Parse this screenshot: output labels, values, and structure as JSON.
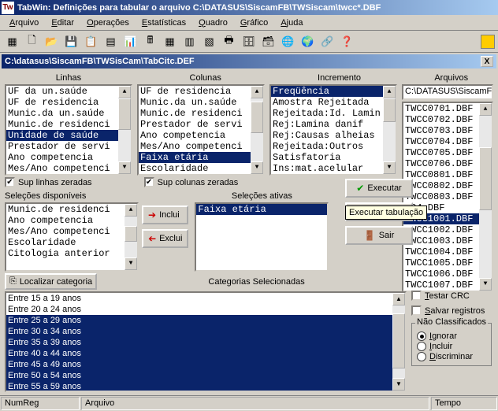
{
  "window": {
    "app_icon": "Tw",
    "title": "TabWin: Definições para tabular o arquivo C:\\DATASUS\\SiscamFB\\TWSiscam\\twcc*.DBF"
  },
  "menu": {
    "arquivo": "Arquivo",
    "editar": "Editar",
    "operacoes": "Operações",
    "estatisticas": "Estatísticas",
    "quadro": "Quadro",
    "grafico": "Gráfico",
    "ajuda": "Ajuda"
  },
  "inner_window": {
    "title": "C:\\datasus\\SiscamFB\\TWSisCam\\TabCitc.DEF",
    "close": "X"
  },
  "headers": {
    "linhas": "Linhas",
    "colunas": "Colunas",
    "incremento": "Incremento",
    "arquivos": "Arquivos"
  },
  "linhas_items": [
    {
      "t": "UF da un.saúde",
      "sel": 0
    },
    {
      "t": "UF de residencia",
      "sel": 0
    },
    {
      "t": "Munic.da un.saúde",
      "sel": 0
    },
    {
      "t": "Munic.de residenci",
      "sel": 0
    },
    {
      "t": "Unidade de saúde",
      "sel": 1
    },
    {
      "t": "Prestador de servi",
      "sel": 0
    },
    {
      "t": "Ano competencia",
      "sel": 0
    },
    {
      "t": "Mes/Ano competenci",
      "sel": 0
    }
  ],
  "colunas_items": [
    {
      "t": "UF de residencia",
      "sel": 0
    },
    {
      "t": "Munic.da un.saúde",
      "sel": 0
    },
    {
      "t": "Munic.de residenci",
      "sel": 0
    },
    {
      "t": "Prestador de servi",
      "sel": 0
    },
    {
      "t": "Ano competencia",
      "sel": 0
    },
    {
      "t": "Mes/Ano competenci",
      "sel": 0
    },
    {
      "t": "Faixa etária",
      "sel": 1
    },
    {
      "t": "Escolaridade",
      "sel": 0
    }
  ],
  "incremento_items": [
    {
      "t": "Freqüência",
      "sel": 1
    },
    {
      "t": "Amostra Rejeitada",
      "sel": 0
    },
    {
      "t": "Rejeitada:Id. Lamin",
      "sel": 0
    },
    {
      "t": "Rej:Lamina danif",
      "sel": 0
    },
    {
      "t": "Rej:Causas alheias",
      "sel": 0
    },
    {
      "t": "Rejeitada:Outros",
      "sel": 0
    },
    {
      "t": "Satisfatoria",
      "sel": 0
    },
    {
      "t": "Ins:mat.acelular",
      "sel": 0
    }
  ],
  "arquivos_path": "C:\\DATASUS\\SiscamFB\\T",
  "arquivos_items": [
    {
      "t": "TWCC0701.DBF",
      "sel": 0
    },
    {
      "t": "TWCC0702.DBF",
      "sel": 0
    },
    {
      "t": "TWCC0703.DBF",
      "sel": 0
    },
    {
      "t": "TWCC0704.DBF",
      "sel": 0
    },
    {
      "t": "TWCC0705.DBF",
      "sel": 0
    },
    {
      "t": "TWCC0706.DBF",
      "sel": 0
    },
    {
      "t": "TWCC0801.DBF",
      "sel": 0
    },
    {
      "t": "TWCC0802.DBF",
      "sel": 0
    },
    {
      "t": "TWCC0803.DBF",
      "sel": 0
    },
    {
      "t": "             804.DBF",
      "sel": 0
    },
    {
      "t": "TWCC1001.DBF",
      "sel": 1
    },
    {
      "t": "TWCC1002.DBF",
      "sel": 0
    },
    {
      "t": "TWCC1003.DBF",
      "sel": 0
    },
    {
      "t": "TWCC1004.DBF",
      "sel": 0
    },
    {
      "t": "TWCC1005.DBF",
      "sel": 0
    },
    {
      "t": "TWCC1006.DBF",
      "sel": 0
    },
    {
      "t": "TWCC1007.DBF",
      "sel": 0
    }
  ],
  "checks": {
    "sup_linhas": "Sup linhas zeradas",
    "sup_colunas": "Sup colunas zeradas"
  },
  "selecoes": {
    "disponiveis_label": "Seleções disponíveis",
    "ativas_label": "Seleções ativas"
  },
  "seldisp_items": [
    {
      "t": "Munic.de residenci",
      "sel": 0
    },
    {
      "t": "Ano competencia",
      "sel": 0
    },
    {
      "t": "Mes/Ano competenci",
      "sel": 0
    },
    {
      "t": "Escolaridade",
      "sel": 0
    },
    {
      "t": "Citologia anterior",
      "sel": 0
    }
  ],
  "selativ_items": [
    {
      "t": "Faixa etária",
      "sel": 1
    }
  ],
  "buttons": {
    "inclui": "Inclui",
    "exclui": "Exclui",
    "executar": "Executar",
    "cancelar": "",
    "sair": "Sair",
    "localizar": "Localizar categoria",
    "cat_sel": "Categorias Selecionadas"
  },
  "tooltip": "Executar tabulação",
  "categorias": [
    {
      "t": "Entre 15 a 19 anos",
      "sel": 0
    },
    {
      "t": "Entre 20 a 24 anos",
      "sel": 0
    },
    {
      "t": "Entre 25 a 29 anos",
      "sel": 1
    },
    {
      "t": "Entre 30 a 34 anos",
      "sel": 1
    },
    {
      "t": "Entre 35 a 39 anos",
      "sel": 1
    },
    {
      "t": "Entre 40 a 44 anos",
      "sel": 1
    },
    {
      "t": "Entre 45 a 49 anos",
      "sel": 1
    },
    {
      "t": "Entre 50 a 54 anos",
      "sel": 1
    },
    {
      "t": "Entre 55 a 59 anos",
      "sel": 1
    }
  ],
  "bottom_checks": {
    "testar": "Testar CRC",
    "salvar": "Salvar registros"
  },
  "radio": {
    "legend": "Não Classificados",
    "ignorar": "Ignorar",
    "incluir": "Incluir",
    "discriminar": "Discriminar"
  },
  "status": {
    "numreg": "NumReg",
    "arquivo": "Arquivo",
    "tempo": "Tempo"
  }
}
